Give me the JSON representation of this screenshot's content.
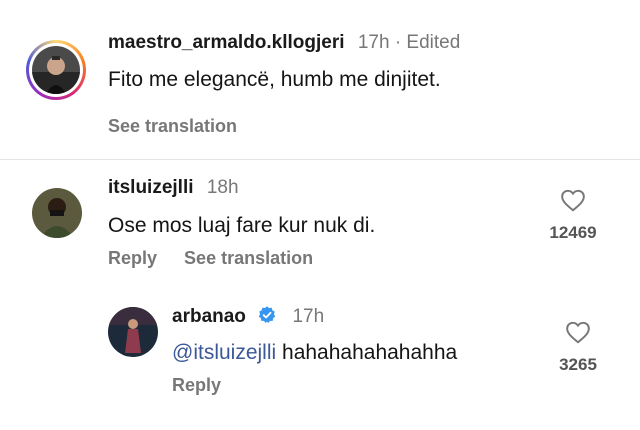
{
  "comments": [
    {
      "username": "maestro_armaldo.kllogjeri",
      "time": "17h",
      "separator": "·",
      "edited": "Edited",
      "text": "Fito me elegancë, humb me dinjitet.",
      "see_translation": "See translation",
      "avatar_icon": "profile-avatar-story-ring"
    },
    {
      "username": "itsluizejlli",
      "time": "18h",
      "text": "Ose mos luaj fare kur nuk di.",
      "reply_label": "Reply",
      "see_translation": "See translation",
      "likes": "12469",
      "avatar_icon": "profile-avatar"
    },
    {
      "username": "arbanao",
      "verified_icon": "verified-badge-icon",
      "time": "17h",
      "mention": "@itsluizejlli",
      "text": "hahahahahahahha",
      "reply_label": "Reply",
      "likes": "3265",
      "avatar_icon": "profile-avatar"
    }
  ],
  "colors": {
    "accent_blue": "#3797f0",
    "story_ring": "#d6249f",
    "mention": "#3b5998"
  }
}
